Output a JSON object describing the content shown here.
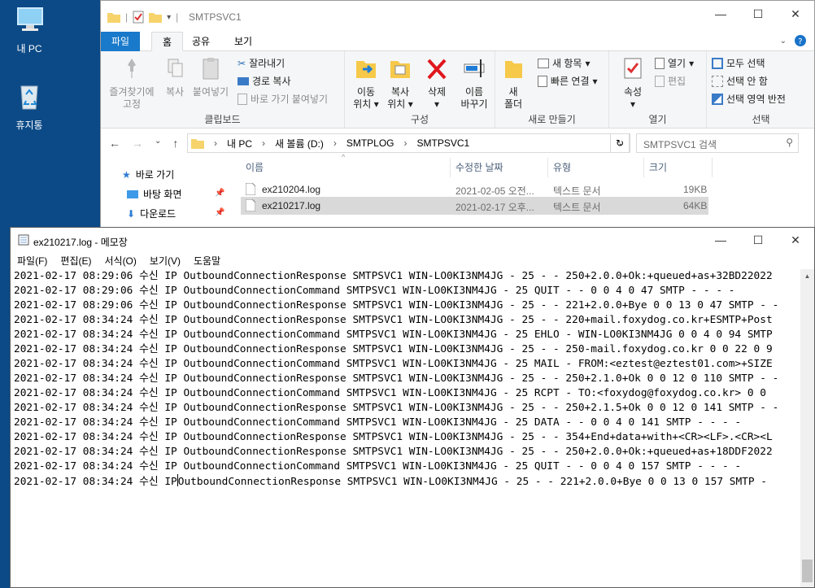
{
  "desktop": {
    "icons": [
      {
        "label": "내 PC",
        "icon": "this-pc-icon"
      },
      {
        "label": "휴지통",
        "icon": "recycle-bin-icon"
      }
    ]
  },
  "explorer": {
    "title": "SMTPSVC1",
    "tabs": [
      "파일",
      "홈",
      "공유",
      "보기"
    ],
    "active_tab": "홈",
    "ribbon": {
      "clipboard": {
        "label": "클립보드",
        "pin": "즐겨찾기에 고정",
        "copy": "복사",
        "paste": "붙여넣기",
        "cut": "잘라내기",
        "copy_path": "경로 복사",
        "paste_shortcut": "바로 가기 붙여넣기"
      },
      "organize": {
        "label": "구성",
        "move_line1": "이동",
        "move_line2": "위치",
        "copyto_line1": "복사",
        "copyto_line2": "위치",
        "delete": "삭제",
        "rename_line1": "이름",
        "rename_line2": "바꾸기"
      },
      "new": {
        "label": "새로 만들기",
        "new_folder_line1": "새",
        "new_folder_line2": "폴더",
        "new_item": "새 항목",
        "easy_access": "빠른 연결"
      },
      "open": {
        "label": "열기",
        "properties": "속성",
        "open": "열기",
        "edit": "편집"
      },
      "select": {
        "label": "선택",
        "select_all": "모두 선택",
        "select_none": "선택 안 함",
        "invert": "선택 영역 반전"
      }
    },
    "address": {
      "parts": [
        "내 PC",
        "새 볼륨 (D:)",
        "SMTPLOG",
        "SMTPSVC1"
      ],
      "search_placeholder": "SMTPSVC1 검색"
    },
    "nav": [
      {
        "label": "바로 가기"
      },
      {
        "label": "바탕 화면"
      },
      {
        "label": "다운로드"
      }
    ],
    "columns": [
      "이름",
      "수정한 날짜",
      "유형",
      "크기"
    ],
    "files": [
      {
        "name": "ex210204.log",
        "date": "2021-02-05 오전...",
        "type": "텍스트 문서",
        "size": "19KB",
        "selected": false
      },
      {
        "name": "ex210217.log",
        "date": "2021-02-17 오후...",
        "type": "텍스트 문서",
        "size": "64KB",
        "selected": true
      }
    ]
  },
  "notepad": {
    "title": "ex210217.log - 메모장",
    "menu": [
      "파일(F)",
      "편집(E)",
      "서식(O)",
      "보기(V)",
      "도움말"
    ],
    "lines": [
      "2021-02-17 08:29:06 수신 IP OutboundConnectionResponse SMTPSVC1 WIN-LO0KI3NM4JG - 25 - - 250+2.0.0+Ok:+queued+as+32BD22022",
      "2021-02-17 08:29:06 수신 IP OutboundConnectionCommand SMTPSVC1 WIN-LO0KI3NM4JG - 25 QUIT - - 0 0 4 0 47 SMTP - - - -",
      "2021-02-17 08:29:06 수신 IP OutboundConnectionResponse SMTPSVC1 WIN-LO0KI3NM4JG - 25 - - 221+2.0.0+Bye 0 0 13 0 47 SMTP - -",
      "2021-02-17 08:34:24 수신 IP OutboundConnectionResponse SMTPSVC1 WIN-LO0KI3NM4JG - 25 - - 220+mail.foxydog.co.kr+ESMTP+Post",
      "2021-02-17 08:34:24 수신 IP OutboundConnectionCommand SMTPSVC1 WIN-LO0KI3NM4JG - 25 EHLO - WIN-LO0KI3NM4JG 0 0 4 0 94 SMTP",
      "2021-02-17 08:34:24 수신 IP OutboundConnectionResponse SMTPSVC1 WIN-LO0KI3NM4JG - 25 - - 250-mail.foxydog.co.kr 0 0 22 0 9",
      "2021-02-17 08:34:24 수신 IP OutboundConnectionCommand SMTPSVC1 WIN-LO0KI3NM4JG - 25 MAIL - FROM:<eztest@eztest01.com>+SIZE",
      "2021-02-17 08:34:24 수신 IP OutboundConnectionResponse SMTPSVC1 WIN-LO0KI3NM4JG - 25 - - 250+2.1.0+Ok 0 0 12 0 110 SMTP - -",
      "2021-02-17 08:34:24 수신 IP OutboundConnectionCommand SMTPSVC1 WIN-LO0KI3NM4JG - 25 RCPT - TO:<foxydog@foxydog.co.kr> 0 0",
      "2021-02-17 08:34:24 수신 IP OutboundConnectionResponse SMTPSVC1 WIN-LO0KI3NM4JG - 25 - - 250+2.1.5+Ok 0 0 12 0 141 SMTP - -",
      "2021-02-17 08:34:24 수신 IP OutboundConnectionCommand SMTPSVC1 WIN-LO0KI3NM4JG - 25 DATA - - 0 0 4 0 141 SMTP - - - -",
      "2021-02-17 08:34:24 수신 IP OutboundConnectionResponse SMTPSVC1 WIN-LO0KI3NM4JG - 25 - - 354+End+data+with+<CR><LF>.<CR><L",
      "2021-02-17 08:34:24 수신 IP OutboundConnectionResponse SMTPSVC1 WIN-LO0KI3NM4JG - 25 - - 250+2.0.0+Ok:+queued+as+18DDF2022",
      "2021-02-17 08:34:24 수신 IP OutboundConnectionCommand SMTPSVC1 WIN-LO0KI3NM4JG - 25 QUIT - - 0 0 4 0 157 SMTP - - - -"
    ],
    "last_line": {
      "before_caret": "2021-02-17 08:34:24 수신 IP",
      "after_caret": "OutboundConnectionResponse SMTPSVC1 WIN-LO0KI3NM4JG - 25 - - 221+2.0.0+Bye 0 0 13 0 157 SMTP -"
    }
  }
}
